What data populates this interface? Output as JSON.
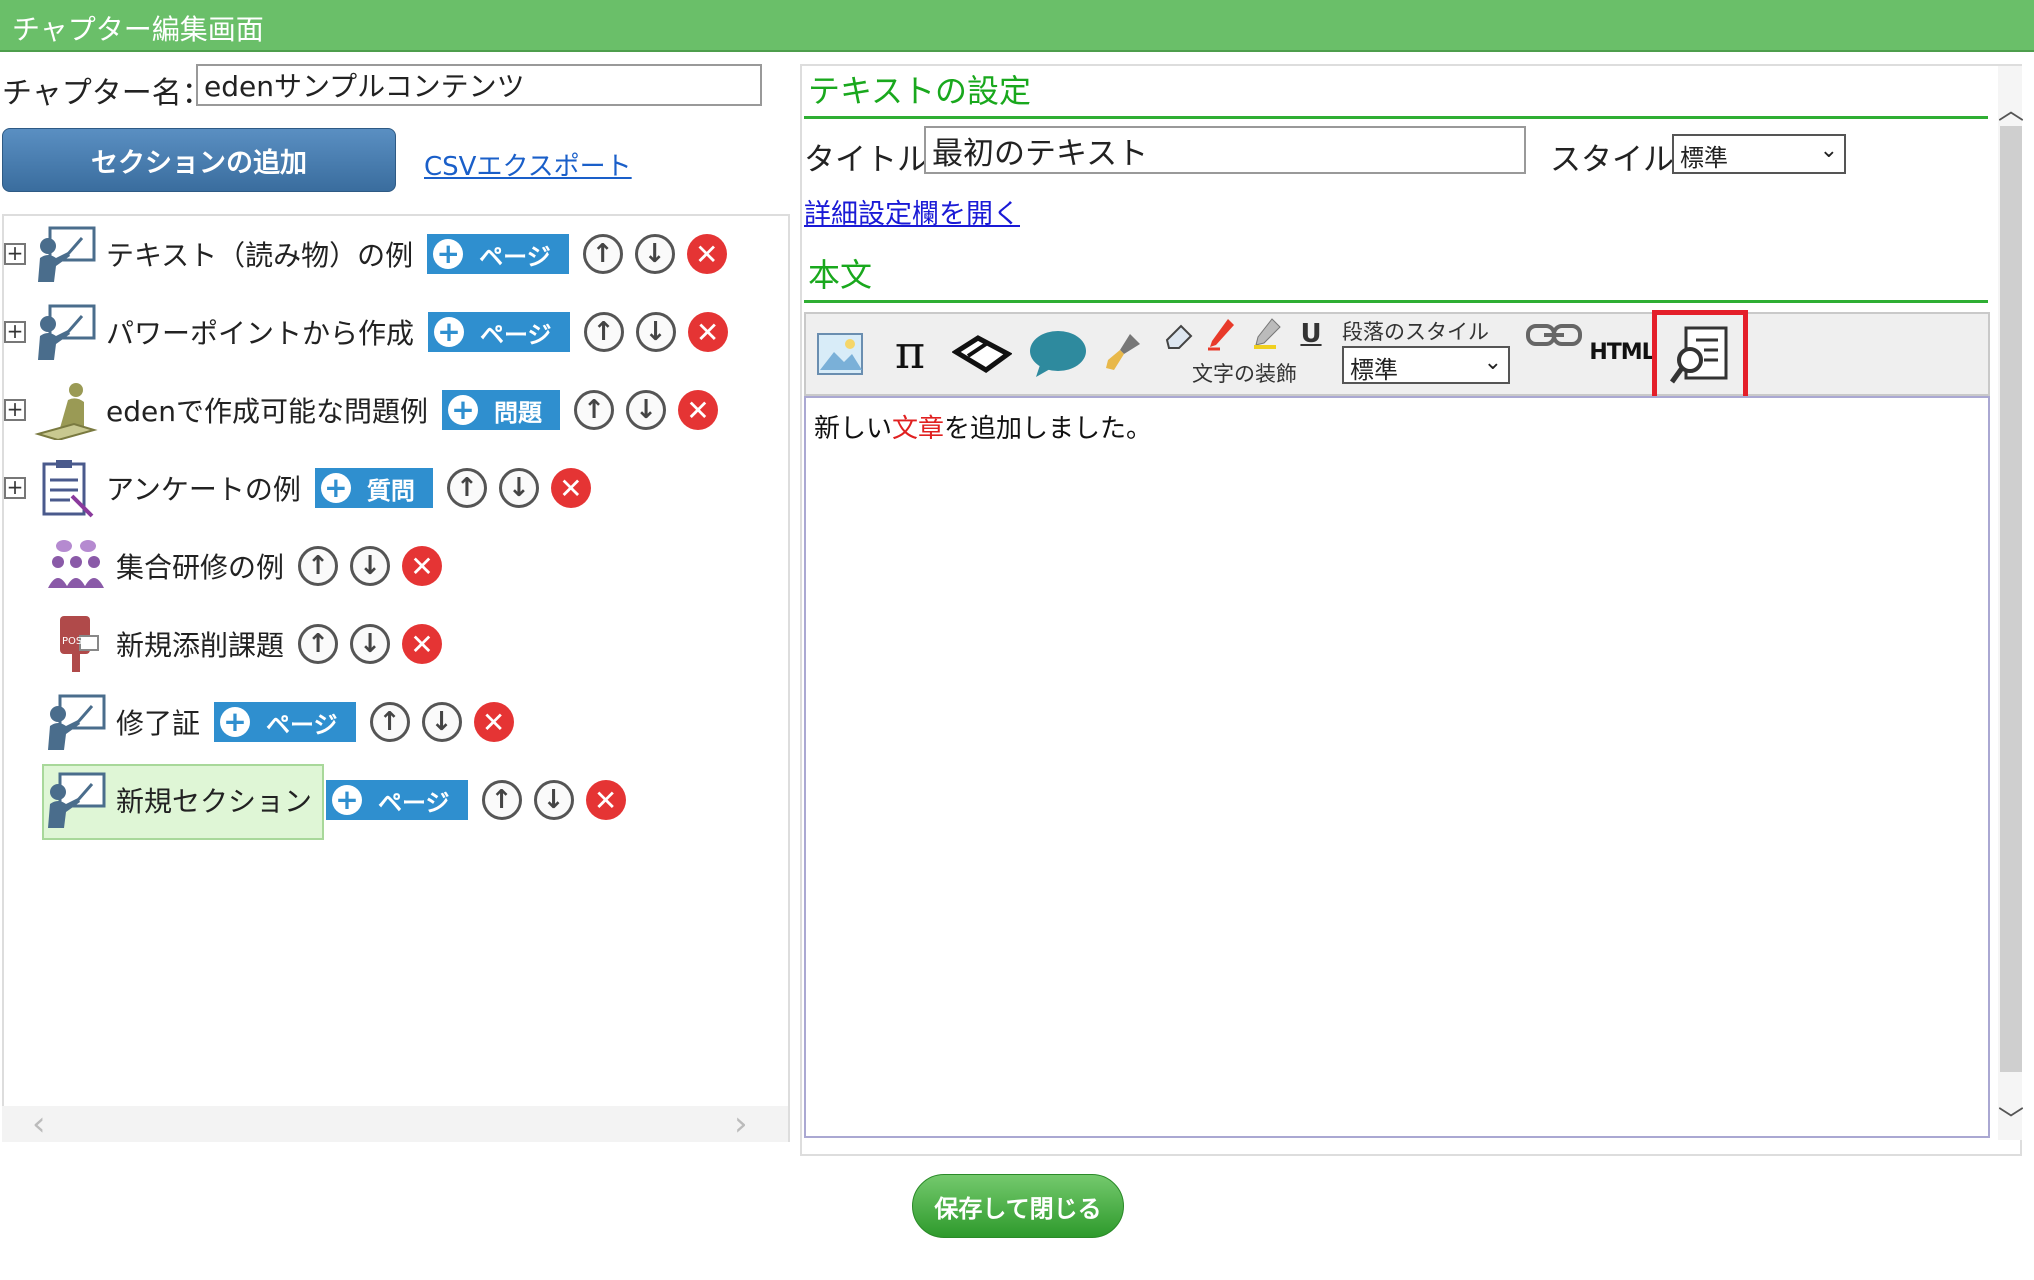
{
  "window": {
    "title": "チャプター編集画面"
  },
  "left": {
    "chapter_label": "チャプター名：",
    "chapter_name": "edenサンプルコンテンツ",
    "add_section_label": "セクションの追加",
    "csv_export_label": "CSVエクスポート",
    "items": [
      {
        "label": "テキスト（読み物）の例",
        "add_label": "ページ",
        "icon": "presenter-icon"
      },
      {
        "label": "パワーポイントから作成",
        "add_label": "ページ",
        "icon": "presenter-icon"
      },
      {
        "label": "edenで作成可能な問題例",
        "add_label": "問題",
        "icon": "studying-person-icon"
      },
      {
        "label": "アンケートの例",
        "add_label": "質問",
        "icon": "clipboard-icon"
      },
      {
        "label": "集合研修の例",
        "icon": "group-training-icon"
      },
      {
        "label": "新規添削課題",
        "icon": "post-box-icon"
      },
      {
        "label": "修了証",
        "add_label": "ページ",
        "icon": "presenter-icon"
      },
      {
        "label": "新規セクション",
        "add_label": "ページ",
        "icon": "presenter-icon"
      }
    ]
  },
  "right": {
    "text_settings_heading": "テキストの設定",
    "title_label": "タイトル:",
    "title_value": "最初のテキスト",
    "style_label": "スタイル:",
    "style_value": "標準",
    "detail_link": "詳細設定欄を開く",
    "body_heading": "本文",
    "toolbar": {
      "paragraph_style_label": "段落のスタイル",
      "paragraph_style_value": "標準",
      "decoration_label": "文字の装飾",
      "html_label": "HTML",
      "pi_label": "π",
      "underline_label": "U"
    },
    "editor": {
      "text_before": "新しい",
      "text_highlight": "文章",
      "text_after": "を追加しました。",
      "highlight_color": "#e02020"
    },
    "save_label": "保存して閉じる"
  },
  "colors": {
    "header_green": "#6abf69",
    "heading_green": "#19a81d",
    "button_blue": "#2f8fcf",
    "delete_red": "#e53434",
    "highlight_red": "#e41f2a"
  }
}
